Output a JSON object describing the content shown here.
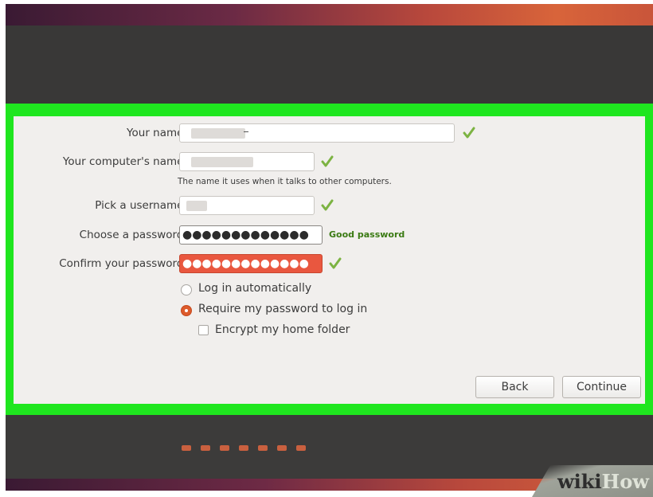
{
  "form": {
    "name_label": "Your name:",
    "computer_label": "Your computer's name:",
    "computer_hint": "The name it uses when it talks to other computers.",
    "username_label": "Pick a username:",
    "password_label": "Choose a password:",
    "password_dots": "●●●●●●●●●●●●●",
    "password_strength": "Good password",
    "confirm_label": "Confirm your password:",
    "confirm_dots": "●●●●●●●●●●●●●"
  },
  "options": {
    "auto_login": {
      "label": "Log in automatically",
      "selected": false
    },
    "require_password": {
      "label": "Require my password to log in",
      "selected": true
    },
    "encrypt_home": {
      "label": "Encrypt my home folder",
      "checked": false
    }
  },
  "buttons": {
    "back": "Back",
    "continue": "Continue"
  },
  "progress": {
    "total_steps": 7
  },
  "watermark": {
    "part1": "wiki",
    "part2": "How"
  },
  "colors": {
    "highlight": "#1fe61f",
    "check": "#7cb342",
    "radio_selected": "#dd5b2b",
    "error_field": "#e9573f",
    "strength_text": "#3a7a13"
  }
}
